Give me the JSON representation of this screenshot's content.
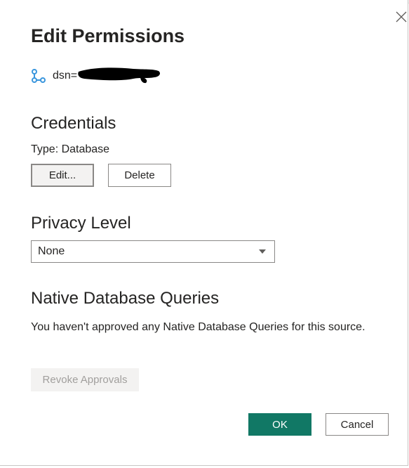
{
  "dialog": {
    "title": "Edit Permissions",
    "close_icon": "close-icon"
  },
  "source": {
    "icon": "data-source-connector-icon",
    "label": "dsn="
  },
  "credentials": {
    "heading": "Credentials",
    "type_label": "Type: Database",
    "edit_label": "Edit...",
    "delete_label": "Delete"
  },
  "privacy": {
    "heading": "Privacy Level",
    "selected": "None"
  },
  "native_queries": {
    "heading": "Native Database Queries",
    "description": "You haven't approved any Native Database Queries for this source.",
    "revoke_label": "Revoke Approvals"
  },
  "footer": {
    "ok_label": "OK",
    "cancel_label": "Cancel"
  },
  "colors": {
    "accent": "#117865",
    "icon_blue": "#3a96dd",
    "disabled_text": "#a19f9d"
  }
}
